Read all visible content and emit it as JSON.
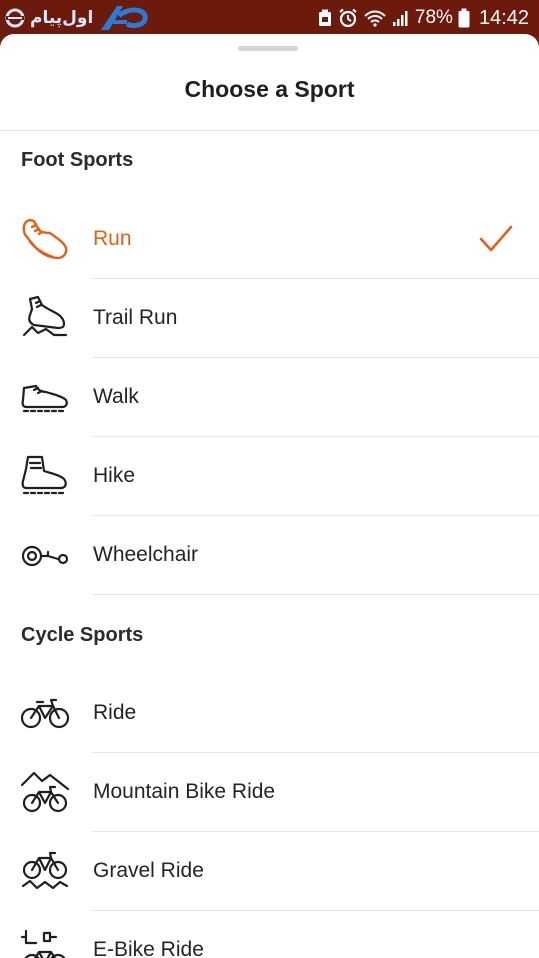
{
  "status_bar": {
    "watermark_text": "اول‌پیام",
    "battery_percent": "78%",
    "time": "14:42"
  },
  "sheet": {
    "title": "Choose a Sport"
  },
  "sections": [
    {
      "title": "Foot Sports",
      "items": [
        {
          "label": "Run",
          "icon": "running-shoe-icon",
          "selected": true
        },
        {
          "label": "Trail Run",
          "icon": "trail-shoe-icon",
          "selected": false
        },
        {
          "label": "Walk",
          "icon": "walking-shoe-icon",
          "selected": false
        },
        {
          "label": "Hike",
          "icon": "hiking-boot-icon",
          "selected": false
        },
        {
          "label": "Wheelchair",
          "icon": "wheelchair-icon",
          "selected": false
        }
      ]
    },
    {
      "title": "Cycle Sports",
      "items": [
        {
          "label": "Ride",
          "icon": "bicycle-icon",
          "selected": false
        },
        {
          "label": "Mountain Bike Ride",
          "icon": "mountain-bike-icon",
          "selected": false
        },
        {
          "label": "Gravel Ride",
          "icon": "gravel-bike-icon",
          "selected": false
        },
        {
          "label": "E-Bike Ride",
          "icon": "e-bike-icon",
          "selected": false
        }
      ]
    }
  ],
  "colors": {
    "accent": "#e0621a",
    "status_bar": "#6b1a0c",
    "text": "#242424"
  }
}
